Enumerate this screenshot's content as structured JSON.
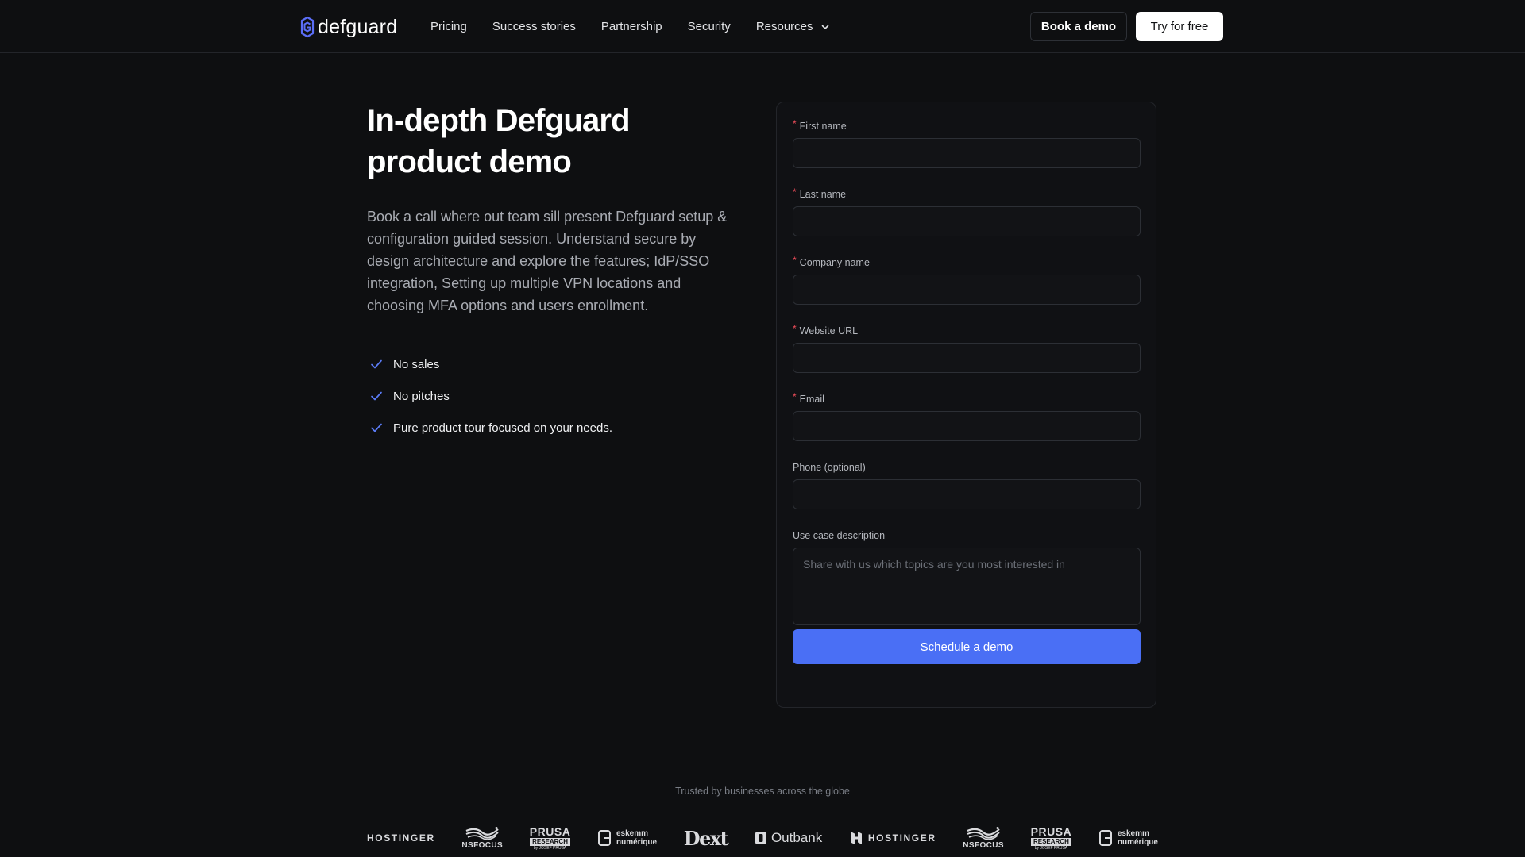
{
  "header": {
    "logo_text": "defguard",
    "nav": [
      {
        "label": "Pricing"
      },
      {
        "label": "Success stories"
      },
      {
        "label": "Partnership"
      },
      {
        "label": "Security"
      },
      {
        "label": "Resources",
        "has_dropdown": true
      }
    ],
    "book_demo_label": "Book a demo",
    "try_free_label": "Try for free"
  },
  "hero": {
    "title": "In-depth Defguard product demo",
    "description": "Book a call where out team sill present Defguard setup & configuration guided session. Understand secure by design architecture and explore the features; IdP/SSO integration, Setting up multiple VPN locations and choosing MFA options and users enrollment.",
    "features": [
      {
        "label": "No sales",
        "icon": "check-icon"
      },
      {
        "label": "No pitches",
        "icon": "check-icon"
      },
      {
        "label": "Pure product tour focused on your needs.",
        "icon": "check-icon"
      }
    ]
  },
  "form": {
    "required_mark": "*",
    "fields": [
      {
        "label": "First name",
        "required": true,
        "value": ""
      },
      {
        "label": "Last name",
        "required": true,
        "value": ""
      },
      {
        "label": "Company name",
        "required": true,
        "value": ""
      },
      {
        "label": "Website URL",
        "required": true,
        "value": ""
      },
      {
        "label": "Email",
        "required": true,
        "value": ""
      },
      {
        "label": "Phone (optional)",
        "required": false,
        "value": ""
      }
    ],
    "use_case": {
      "label": "Use case description",
      "placeholder": "Share with us which topics are you most interested in",
      "value": ""
    },
    "submit_label": "Schedule a demo"
  },
  "trusted": {
    "caption": "Trusted by businesses across the globe",
    "logos": [
      {
        "name": "HOSTINGER"
      },
      {
        "name": "NSFOCUS"
      },
      {
        "name": "PRUSA RESEARCH",
        "line1": "PRUSA",
        "line2": "RESEARCH",
        "line3": "by JOSEF PRUSA"
      },
      {
        "name": "eskemm numérique",
        "line1": "eskemm",
        "line2": "numérique"
      },
      {
        "name": "Dext"
      },
      {
        "name": "Outbank"
      },
      {
        "name": "HOSTINGER"
      },
      {
        "name": "NSFOCUS"
      },
      {
        "name": "PRUSA RESEARCH",
        "line1": "PRUSA",
        "line2": "RESEARCH",
        "line3": "by JOSEF PRUSA"
      },
      {
        "name": "eskemm numérique",
        "line1": "eskemm",
        "line2": "numérique"
      }
    ]
  },
  "colors": {
    "background": "#0e0f11",
    "accent": "#4a6ff5",
    "required": "#ef4d5a",
    "logo_mark": "#5b6ef7"
  }
}
